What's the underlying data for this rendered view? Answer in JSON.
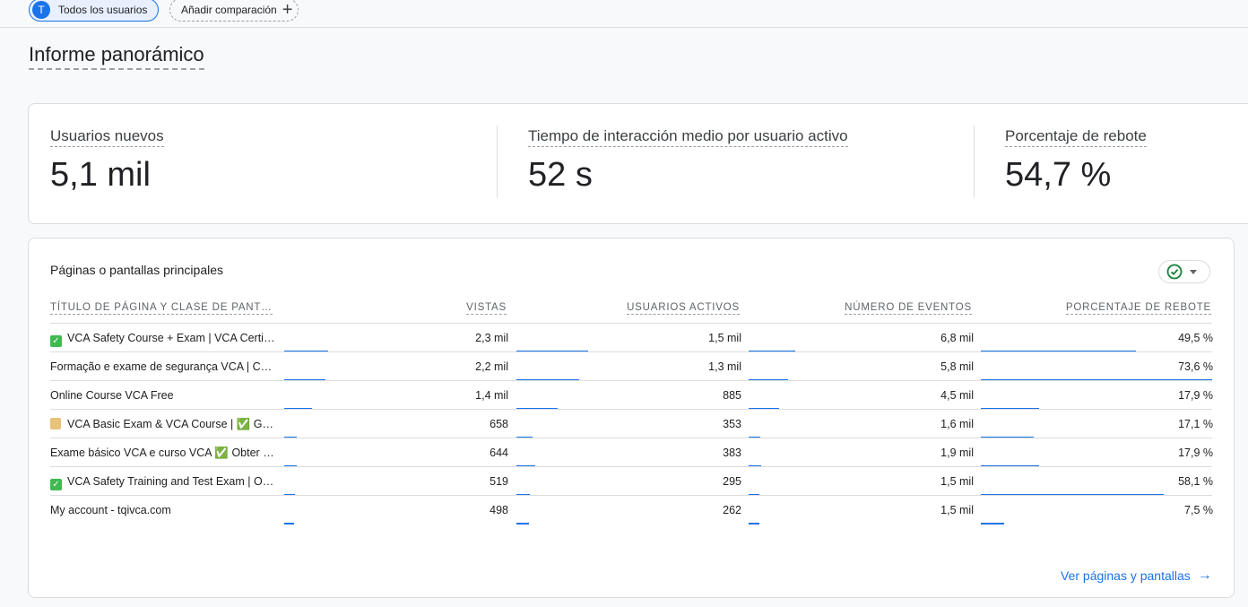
{
  "top": {
    "user_chip": {
      "avatar": "T",
      "label": "Todos los usuarios"
    },
    "compare_chip": {
      "label": "Añadir comparación",
      "icon": "plus-icon"
    }
  },
  "page_title": "Informe panorámico",
  "kpis": [
    {
      "label": "Usuarios nuevos",
      "value": "5,1 mil"
    },
    {
      "label": "Tiempo de interacción medio por usuario activo",
      "value": "52 s"
    },
    {
      "label": "Porcentaje de rebote",
      "value": "54,7 %"
    }
  ],
  "table": {
    "title": "Páginas o pantallas principales",
    "columns": [
      "TÍTULO DE PÁGINA Y CLASE DE PANT…",
      "VISTAS",
      "USUARIOS ACTIVOS",
      "NÚMERO DE EVENTOS",
      "PORCENTAJE DE REBOTE"
    ],
    "rows": [
      {
        "icon": "check",
        "title": "VCA Safety Course + Exam | VCA Certificate",
        "views": "2,3 mil",
        "users": "1,5 mil",
        "events": "6,8 mil",
        "bounce": "49,5 %",
        "b": [
          0.19,
          0.31,
          0.2,
          0.67
        ]
      },
      {
        "icon": "",
        "title": "Formação e exame de segurança VCA | Certificado",
        "views": "2,2 mil",
        "users": "1,3 mil",
        "events": "5,8 mil",
        "bounce": "73,6 %",
        "b": [
          0.18,
          0.27,
          0.17,
          1.0
        ]
      },
      {
        "icon": "",
        "title": "Online Course VCA Free",
        "views": "1,4 mil",
        "users": "885",
        "events": "4,5 mil",
        "bounce": "17,9 %",
        "b": [
          0.12,
          0.18,
          0.13,
          0.25
        ]
      },
      {
        "icon": "scroll",
        "title": "VCA Basic Exam & VCA Course | ✅ Get certified",
        "views": "658",
        "users": "353",
        "events": "1,6 mil",
        "bounce": "17,1 %",
        "b": [
          0.055,
          0.07,
          0.05,
          0.23
        ]
      },
      {
        "icon": "",
        "title": "Exame básico VCA e curso VCA ✅ Obter certificado",
        "views": "644",
        "users": "383",
        "events": "1,9 mil",
        "bounce": "17,9 %",
        "b": [
          0.055,
          0.08,
          0.055,
          0.25
        ]
      },
      {
        "icon": "check",
        "title": "VCA Safety Training and Test Exam | Online",
        "views": "519",
        "users": "295",
        "events": "1,5 mil",
        "bounce": "58,1 %",
        "b": [
          0.045,
          0.06,
          0.045,
          0.79
        ]
      },
      {
        "icon": "",
        "title": "My account - tqivca.com",
        "views": "498",
        "users": "262",
        "events": "1,5 mil",
        "bounce": "7,5 %",
        "b": [
          0.042,
          0.055,
          0.045,
          0.1
        ]
      }
    ],
    "link": "Ver páginas y pantallas"
  },
  "colors": {
    "accent": "#1a73e8",
    "check_green": "#188038"
  }
}
